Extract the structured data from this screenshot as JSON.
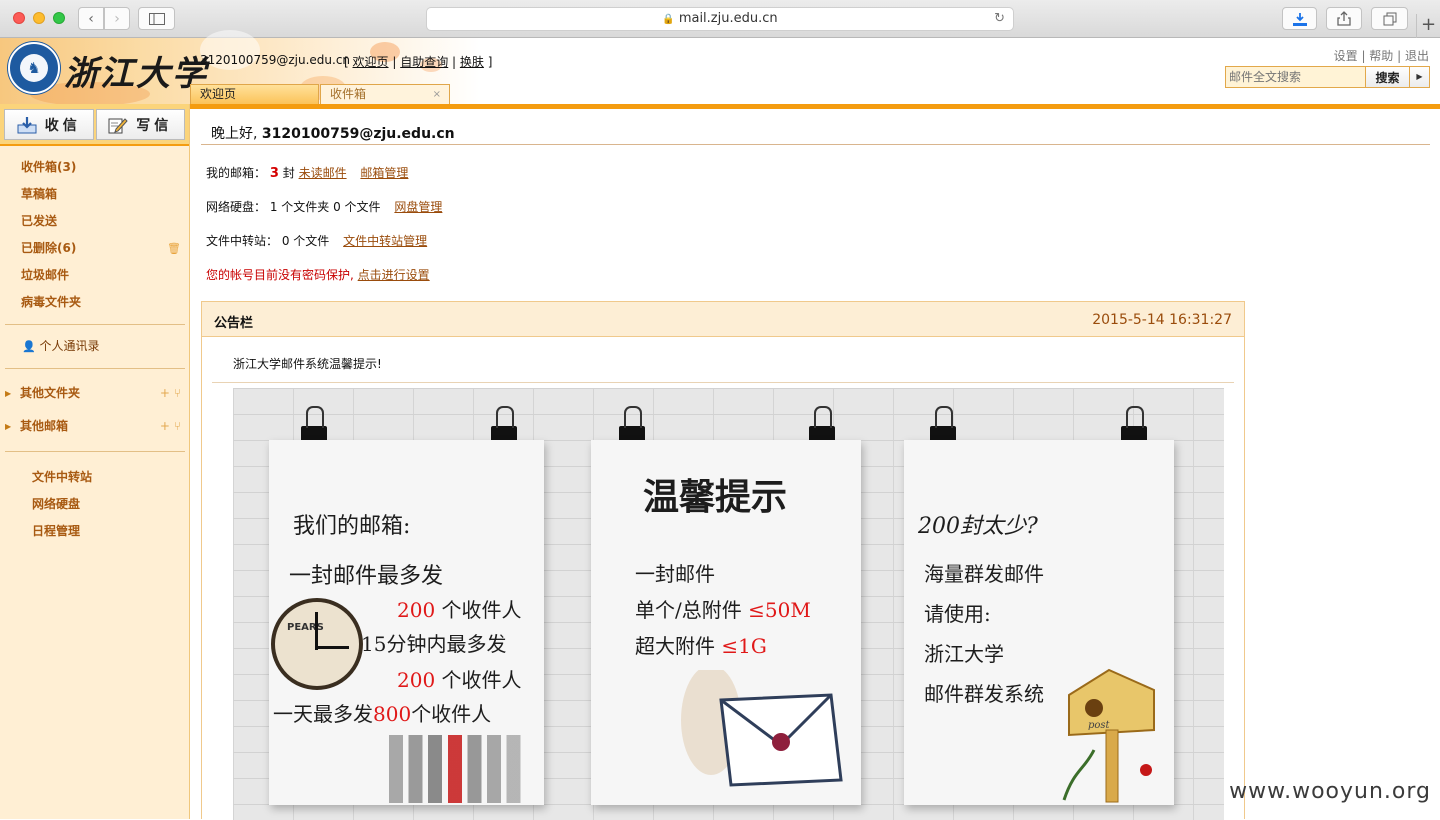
{
  "browser": {
    "url": "mail.zju.edu.cn"
  },
  "header": {
    "logo_text": "浙江大学",
    "user_email": "3120100759@zju.edu.cn",
    "top_links": {
      "open": "[",
      "welcome": "欢迎页",
      "self_query": "自助查询",
      "skin": "换肤",
      "close": "]"
    },
    "right_links": {
      "settings": "设置",
      "help": "帮助",
      "logout": "退出"
    },
    "search": {
      "placeholder": "邮件全文搜索",
      "button": "搜索"
    },
    "tabs": [
      {
        "label": "欢迎页",
        "active": true
      },
      {
        "label": "收件箱",
        "active": false
      }
    ]
  },
  "sidebar": {
    "receive_label": "收信",
    "compose_label": "写信",
    "folders": [
      {
        "label": "收件箱(3)"
      },
      {
        "label": "草稿箱"
      },
      {
        "label": "已发送"
      },
      {
        "label": "已删除(6)"
      },
      {
        "label": "垃圾邮件"
      },
      {
        "label": "病毒文件夹"
      }
    ],
    "contacts_label": "个人通讯录",
    "groups": [
      {
        "label": "其他文件夹"
      },
      {
        "label": "其他邮箱"
      }
    ],
    "tools": [
      {
        "label": "文件中转站"
      },
      {
        "label": "网络硬盘"
      },
      {
        "label": "日程管理"
      }
    ]
  },
  "main": {
    "greeting_prefix": "晚上好,",
    "greeting_user": "3120100759@zju.edu.cn",
    "mailbox": {
      "label": "我的邮箱：",
      "count": "3",
      "unit": "封",
      "unread_link": "未读邮件",
      "manage_link": "邮箱管理"
    },
    "netdisk": {
      "label": "网络硬盘：",
      "value": "1 个文件夹 0 个文件",
      "manage_link": "网盘管理"
    },
    "transfer": {
      "label": "文件中转站：",
      "value": "0 个文件",
      "manage_link": "文件中转站管理"
    },
    "warning": {
      "text": "您的帐号目前没有密码保护,",
      "link": "点击进行设置"
    },
    "notice": {
      "title": "公告栏",
      "date": "2015-5-14 16:31:27",
      "subtitle": "浙江大学邮件系统温馨提示!",
      "poster": {
        "left_lines": [
          "我们的邮箱:",
          "一封邮件最多发",
          "200",
          "个收件人",
          "15分钟内最多发",
          "200",
          "个收件人",
          "一天最多发",
          "800",
          "个收件人"
        ],
        "clock_label": "PEARS",
        "center_title": "温馨提示",
        "center_lines": [
          "一封邮件",
          "单个/总附件",
          "≤50M",
          "超大附件",
          "≤1G"
        ],
        "right_lines": [
          "200封太少?",
          "海量群发邮件",
          "请使用:",
          "浙江大学",
          "邮件群发系统"
        ],
        "mailbox_label": "post"
      }
    }
  },
  "watermark": "www.wooyun.org"
}
